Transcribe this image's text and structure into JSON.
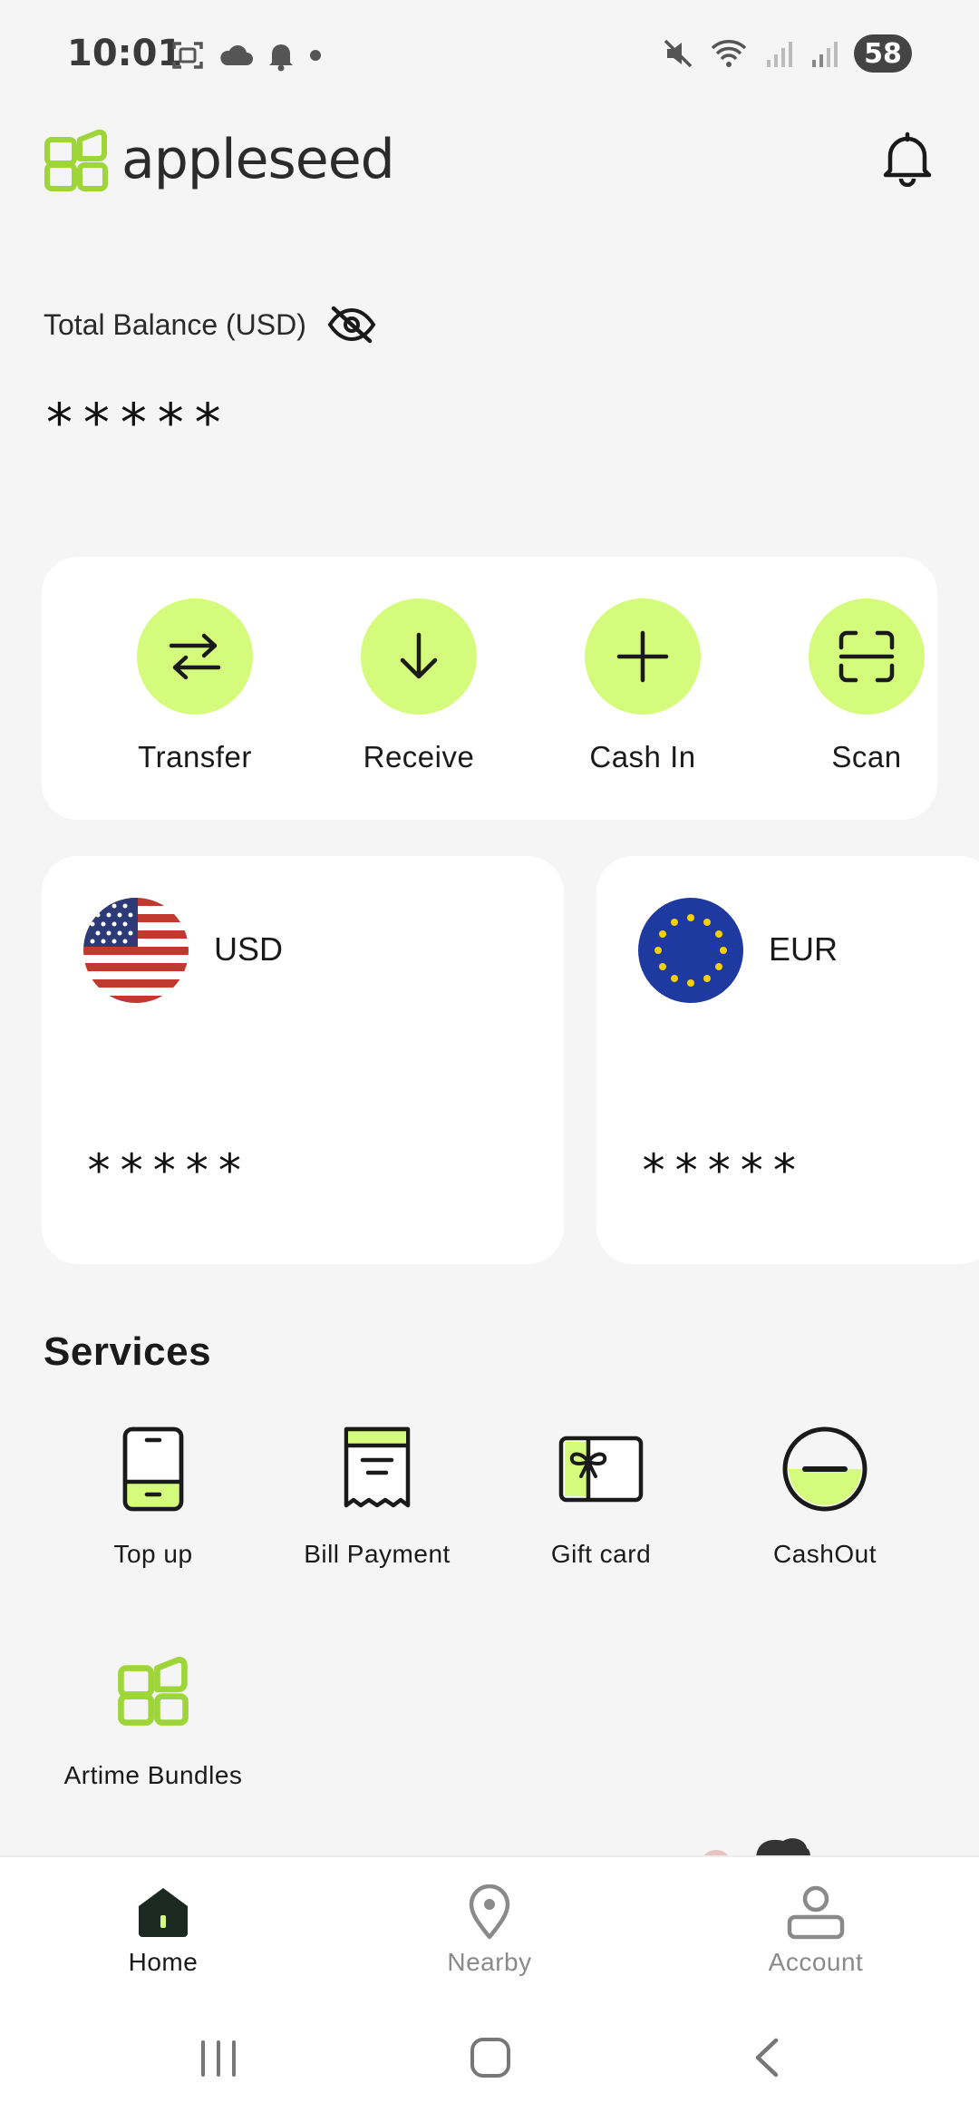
{
  "status_bar": {
    "time": "10:01",
    "battery": "58"
  },
  "header": {
    "logo_text": "appleseed"
  },
  "balance": {
    "label": "Total Balance (USD)",
    "value": "*****"
  },
  "actions": [
    {
      "label": "Transfer",
      "icon": "transfer-arrows-icon"
    },
    {
      "label": "Receive",
      "icon": "arrow-down-icon"
    },
    {
      "label": "Cash In",
      "icon": "plus-icon"
    },
    {
      "label": "Scan",
      "icon": "scan-frame-icon"
    }
  ],
  "currencies": [
    {
      "code": "USD",
      "amount": "*****",
      "icon": "us-flag-icon"
    },
    {
      "code": "EUR",
      "amount": "*****",
      "icon": "eu-flag-icon"
    }
  ],
  "services": {
    "title": "Services",
    "items": [
      {
        "label": "Top up",
        "icon": "phone-icon"
      },
      {
        "label": "Bill Payment",
        "icon": "receipt-icon"
      },
      {
        "label": "Gift card",
        "icon": "gift-card-icon"
      },
      {
        "label": "CashOut",
        "icon": "cashout-icon"
      },
      {
        "label": "Artime Bundles",
        "icon": "appleseed-bundle-icon"
      }
    ]
  },
  "bottom_nav": [
    {
      "label": "Home",
      "icon": "home-icon",
      "active": true
    },
    {
      "label": "Nearby",
      "icon": "location-pin-icon",
      "active": false
    },
    {
      "label": "Account",
      "icon": "person-icon",
      "active": false
    }
  ],
  "colors": {
    "accent": "#d4fb7b",
    "logo_green": "#9ed63a",
    "background": "#f5f5f5"
  }
}
